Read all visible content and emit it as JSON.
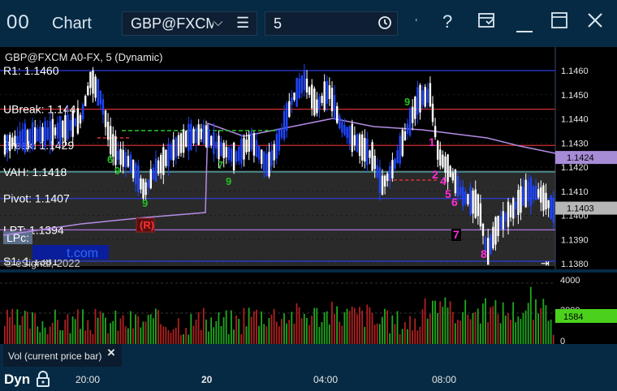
{
  "window": {
    "app_icon": "00",
    "title": "Chart",
    "symbol": "GBP@FXCM",
    "interval": "5",
    "icons": [
      "chevron-down-icon",
      "menu-icon",
      "clock-icon",
      "cursor-icon",
      "help-icon",
      "template-icon",
      "maximize-icon",
      "close-icon"
    ]
  },
  "chart": {
    "header": "GBP@FXCM A0-FX, 5 (Dynamic)",
    "copyright": "© eSignal, 2022",
    "watermark": "t.com",
    "levels": [
      {
        "label": "R1: 1.1460",
        "price": 1.146,
        "color": "#2b3fe0"
      },
      {
        "label": "UBreak: 1.144",
        "price": 1.1444,
        "color": "#d23030"
      },
      {
        "label": "Break: 1.1429",
        "price": 1.1429,
        "color": "#d23030"
      },
      {
        "label": "VAH: 1.1418",
        "price": 1.1418,
        "color": "#59c3c3"
      },
      {
        "label": "Pivot: 1.1407",
        "price": 1.1407,
        "color": "#2b3fe0"
      },
      {
        "label": "LPT: 1.1394",
        "price": 1.1394,
        "color": "#b070e0"
      },
      {
        "label": "S1: 1.1381",
        "price": 1.1381,
        "color": "#2b3fe0"
      }
    ],
    "lpc_label": "LPc:",
    "price_axis": [
      "1.1460",
      "1.1450",
      "1.1440",
      "1.1430",
      "1.1420",
      "1.1410",
      "1.1400",
      "1.1390",
      "1.1380"
    ],
    "last_price_tags": [
      {
        "value": "1.1424",
        "color": "#a68cd6"
      },
      {
        "value": "1.1403",
        "color": "#b6b6b6"
      }
    ],
    "marker_r": "R",
    "magenta_counts": [
      "1",
      "2",
      "4",
      "5",
      "6",
      "7",
      "8"
    ],
    "green_counts": [
      "9",
      "9",
      "9",
      "9",
      "6",
      "7"
    ]
  },
  "volume": {
    "axis": [
      "4000",
      "2000",
      "0"
    ],
    "last_value": "1584",
    "label": "Vol (current price bar)",
    "close_icon": "×"
  },
  "time_axis": {
    "mode": "Dyn",
    "labels": [
      "20:00",
      "20",
      "04:00",
      "08:00"
    ]
  }
}
